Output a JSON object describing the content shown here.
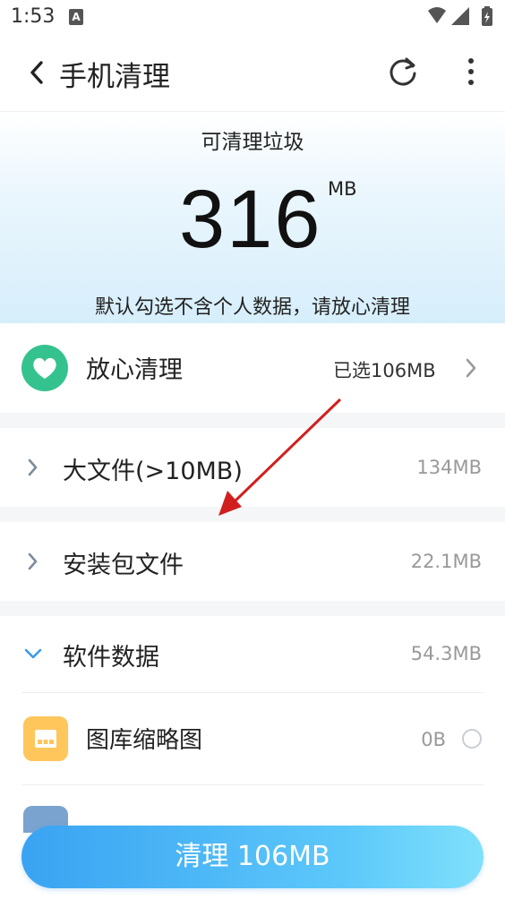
{
  "status": {
    "time": "1:53",
    "notif_glyph": "A"
  },
  "appbar": {
    "title": "手机清理",
    "icons": [
      "back-icon",
      "refresh-icon",
      "more-vert-icon"
    ]
  },
  "hero": {
    "label": "可清理垃圾",
    "value": "316",
    "unit": "MB",
    "note": "默认勾选不含个人数据，请放心清理"
  },
  "safe_clean": {
    "title": "放心清理",
    "selected": "已选106MB",
    "icon": "heart-icon",
    "accent": "#34c38f"
  },
  "items": [
    {
      "title": "大文件(>10MB)",
      "size": "134MB"
    },
    {
      "title": "安装包文件",
      "size": "22.1MB"
    },
    {
      "title": "软件数据",
      "size": "54.3MB"
    }
  ],
  "subitems": [
    {
      "title": "图库缩略图",
      "size": "0B",
      "icon": "gallery-thumbnail-icon"
    }
  ],
  "clean_button": {
    "label": "清理 106MB"
  },
  "colors": {
    "button_start": "#3aa3f2",
    "button_end": "#7fe0fb",
    "expand_chevron": "#3a9be8",
    "annotation_arrow": "#d11f1f"
  }
}
